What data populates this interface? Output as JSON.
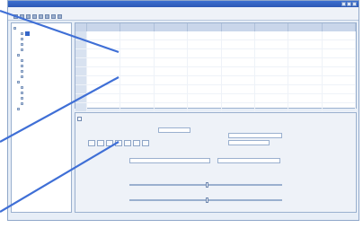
{
  "app": {
    "title": "",
    "menu": [],
    "toolbar_icons": [
      "new-icon",
      "open-icon",
      "save-icon",
      "print-icon",
      "cut-icon",
      "copy-icon",
      "paste-icon",
      "undo-icon"
    ]
  },
  "tree": {
    "items": [
      {
        "label": "",
        "selected": false
      },
      {
        "label": "",
        "selected": true
      },
      {
        "label": "",
        "selected": false
      },
      {
        "label": "",
        "selected": false
      },
      {
        "label": "",
        "selected": false
      },
      {
        "label": "",
        "selected": false
      },
      {
        "label": "",
        "selected": false
      },
      {
        "label": "",
        "selected": false
      },
      {
        "label": "",
        "selected": false
      },
      {
        "label": "",
        "selected": false
      },
      {
        "label": "",
        "selected": false
      },
      {
        "label": "",
        "selected": false
      },
      {
        "label": "",
        "selected": false
      },
      {
        "label": "",
        "selected": false
      },
      {
        "label": "",
        "selected": false
      },
      {
        "label": "",
        "selected": false
      }
    ]
  },
  "grid": {
    "columns": [
      "",
      "",
      "",
      "",
      "",
      "",
      "",
      ""
    ],
    "row_count": 11
  },
  "panel": {
    "title": "",
    "labels": [
      "",
      "",
      "",
      ""
    ]
  },
  "colors": {
    "accent": "#3566c9",
    "callout": "#3f6fd6"
  }
}
